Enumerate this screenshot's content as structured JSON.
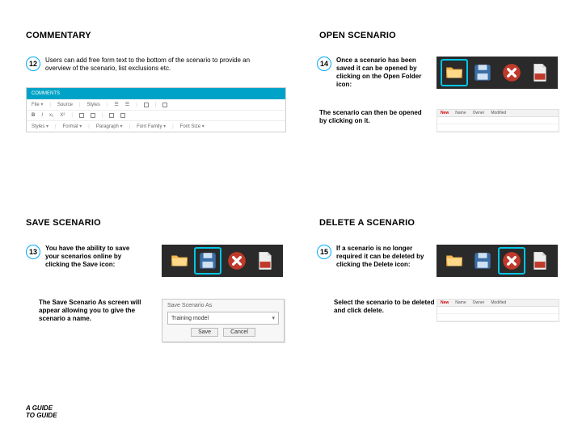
{
  "headings": {
    "commentary": "COMMENTARY",
    "open": "OPEN SCENARIO",
    "save": "SAVE SCENARIO",
    "delete": "DELETE A SCENARIO"
  },
  "steps": {
    "s12": {
      "num": "12",
      "text": "Users can add free form text to the bottom of the scenario to provide an overview of the scenario, list exclusions etc."
    },
    "s13": {
      "num": "13",
      "text": "You have the ability to save your scenarios online by clicking the Save icon:"
    },
    "s14": {
      "num": "14",
      "text": "Once a scenario has been saved it can be opened by clicking on the Open Folder icon:"
    },
    "s15": {
      "num": "15",
      "text": "If a scenario is no longer required it can be deleted by clicking the Delete icon:"
    }
  },
  "follow": {
    "open": "The scenario can then be opened by clicking on it.",
    "save": "The Save Scenario As screen will appear allowing you to give the scenario a name.",
    "delete": "Select the scenario to be deleted and click delete."
  },
  "editor": {
    "title": "COMMENTS",
    "row1": {
      "a": "File",
      "b": "Source",
      "c": "Styles",
      "d": "☰",
      "e": "☰"
    },
    "row2": {
      "a": "B",
      "b": "I",
      "c": "x₂",
      "d": "X²"
    },
    "row3": {
      "styles": "Styles",
      "format": "Format",
      "paragraph": "Paragraph",
      "font": "Font Family",
      "size": "Font Size"
    }
  },
  "dialog": {
    "title": "Save Scenario As",
    "value": "Training model",
    "save": "Save",
    "cancel": "Cancel"
  },
  "list": {
    "h1": "New",
    "c1": "Name",
    "c2": "Owner",
    "c3": "Modified"
  },
  "footer": {
    "l1": "A GUIDE",
    "l2": "TO GUIDE"
  }
}
